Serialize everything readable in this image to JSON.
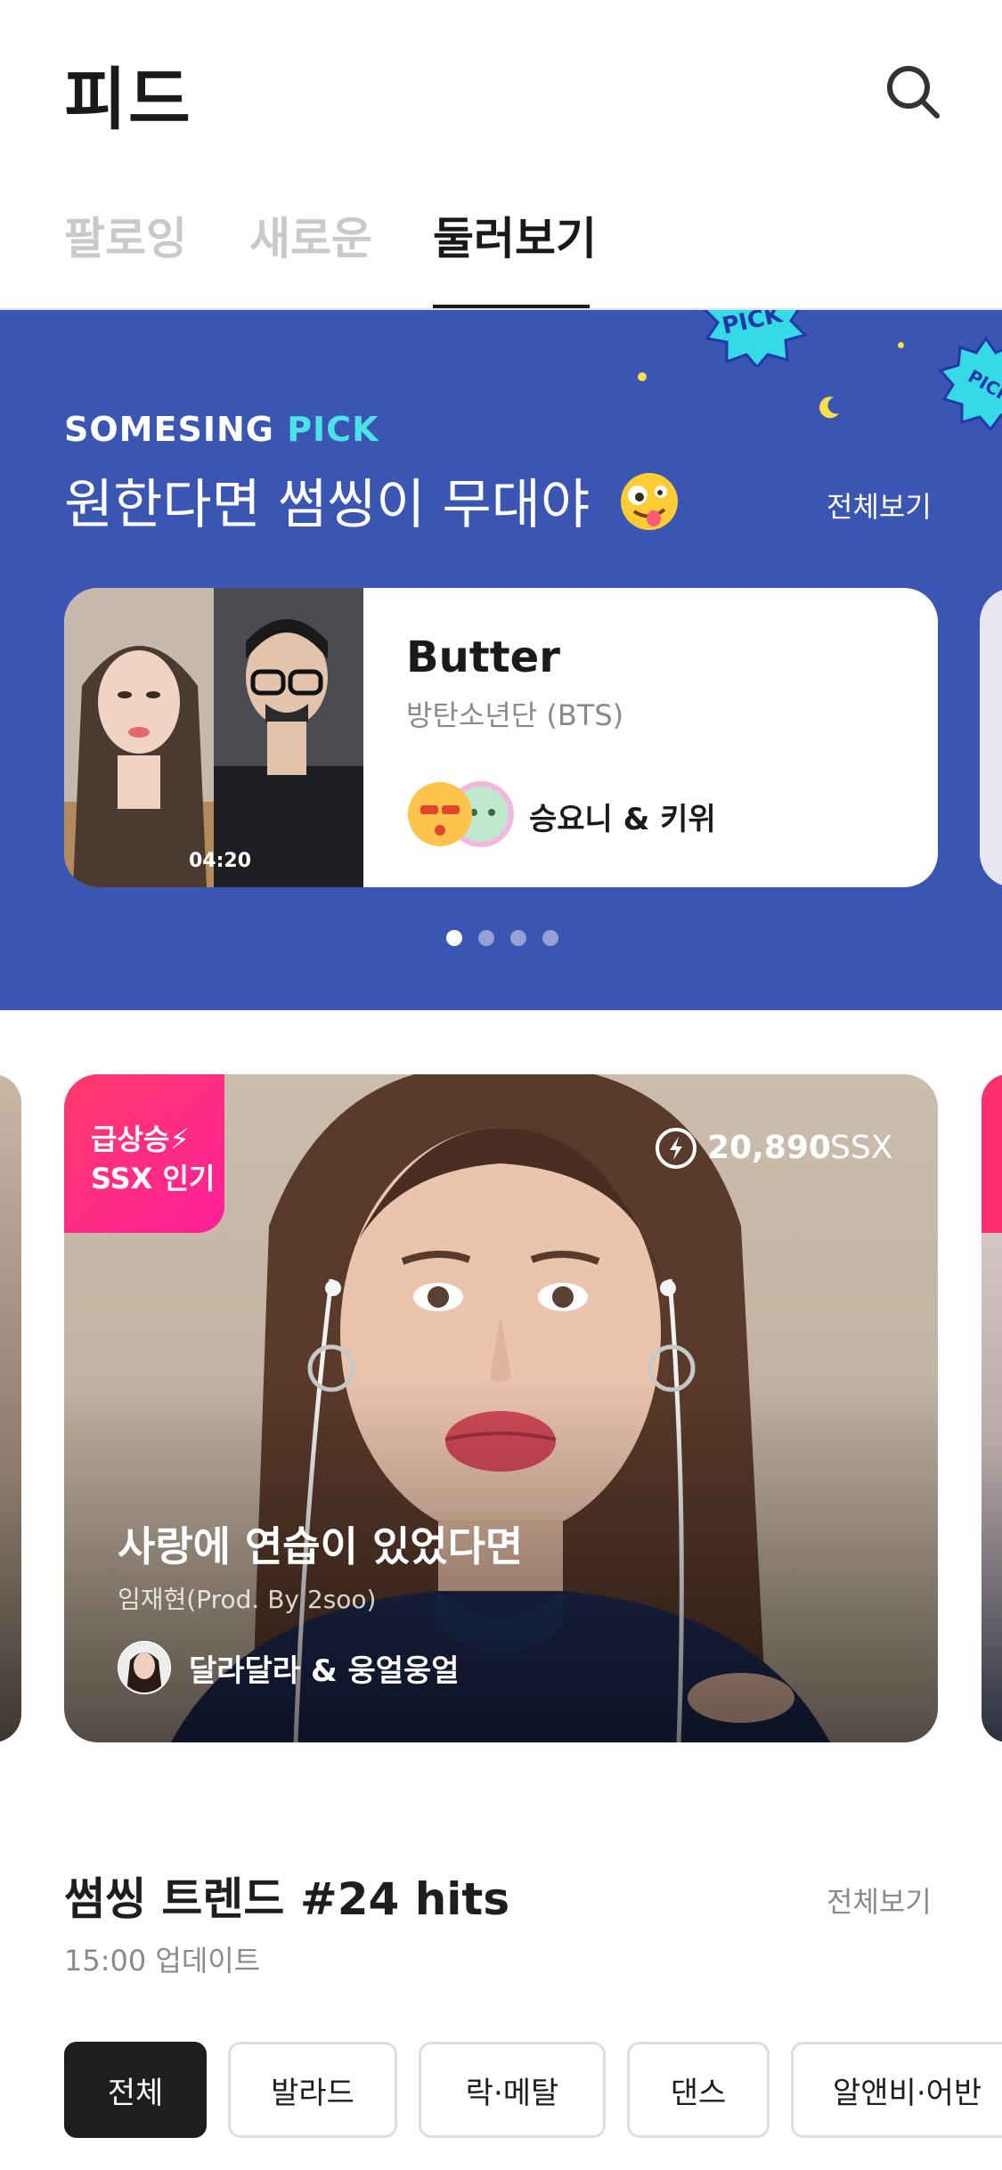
{
  "header": {
    "title": "피드",
    "search_icon": "search-icon",
    "tabs": [
      {
        "label": "팔로잉",
        "active": false
      },
      {
        "label": "새로운",
        "active": false
      },
      {
        "label": "둘러보기",
        "active": true
      }
    ]
  },
  "pick": {
    "brand_part1": "SOMESING",
    "brand_part2": "PICK",
    "headline": "원한다면 썸씽이 무대야",
    "headline_emoji": "zany-face-emoji",
    "see_all": "전체보기",
    "background_color": "#3b55b2",
    "card": {
      "song": "Butter",
      "artist": "방탄소년단 (BTS)",
      "duration": "04:20",
      "singers": "승요니 & 키위"
    },
    "pager": {
      "count": 4,
      "active_index": 0
    }
  },
  "feed_card": {
    "badge_line1": "급상승⚡",
    "badge_line2": "SSX 인기",
    "ssx_value": "20,890",
    "ssx_unit": "SSX",
    "song": "사랑에 연습이 있었다면",
    "artist": "임재현(Prod. By 2soo)",
    "singers": "달라달라 & 웅얼웅얼",
    "badge_color": "#ff2e6e"
  },
  "trend": {
    "title": "썸씽 트렌드 #24 hits",
    "see_all": "전체보기",
    "updated": "15:00 업데이트",
    "chips": [
      {
        "label": "전체",
        "active": true
      },
      {
        "label": "발라드",
        "active": false
      },
      {
        "label": "락·메탈",
        "active": false
      },
      {
        "label": "댄스",
        "active": false
      },
      {
        "label": "알앤비·어반",
        "active": false
      }
    ]
  }
}
